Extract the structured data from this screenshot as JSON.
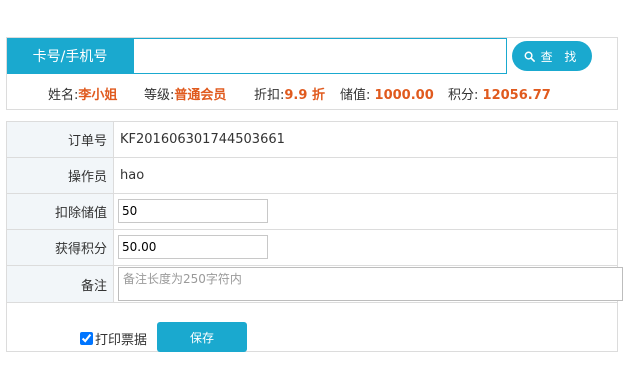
{
  "search": {
    "label": "卡号/手机号",
    "value": "",
    "placeholder": "",
    "button_label": "查 找",
    "button_icon": "search-icon"
  },
  "member": {
    "name_label": "姓名:",
    "name_value": "李小姐",
    "level_label": "等级:",
    "level_value": "普通会员",
    "discount_label": "折扣:",
    "discount_value": "9.9 折",
    "balance_label": "储值:",
    "balance_value": "1000.00",
    "points_label": "积分:",
    "points_value": "12056.77"
  },
  "form": {
    "order_label": "订单号",
    "order_value": "KF201606301744503661",
    "operator_label": "操作员",
    "operator_value": "hao",
    "deduct_label": "扣除储值",
    "deduct_value": "50",
    "points_label": "获得积分",
    "points_value": "50.00",
    "remark_label": "备注",
    "remark_placeholder": "备注长度为250字符内",
    "print_label": "打印票据",
    "print_checked": true,
    "save_label": "保存"
  },
  "colors": {
    "accent": "#1aa9cf",
    "highlight": "#e05a1e",
    "label_bg": "#f2f6f9",
    "border": "#dcdcdc"
  }
}
